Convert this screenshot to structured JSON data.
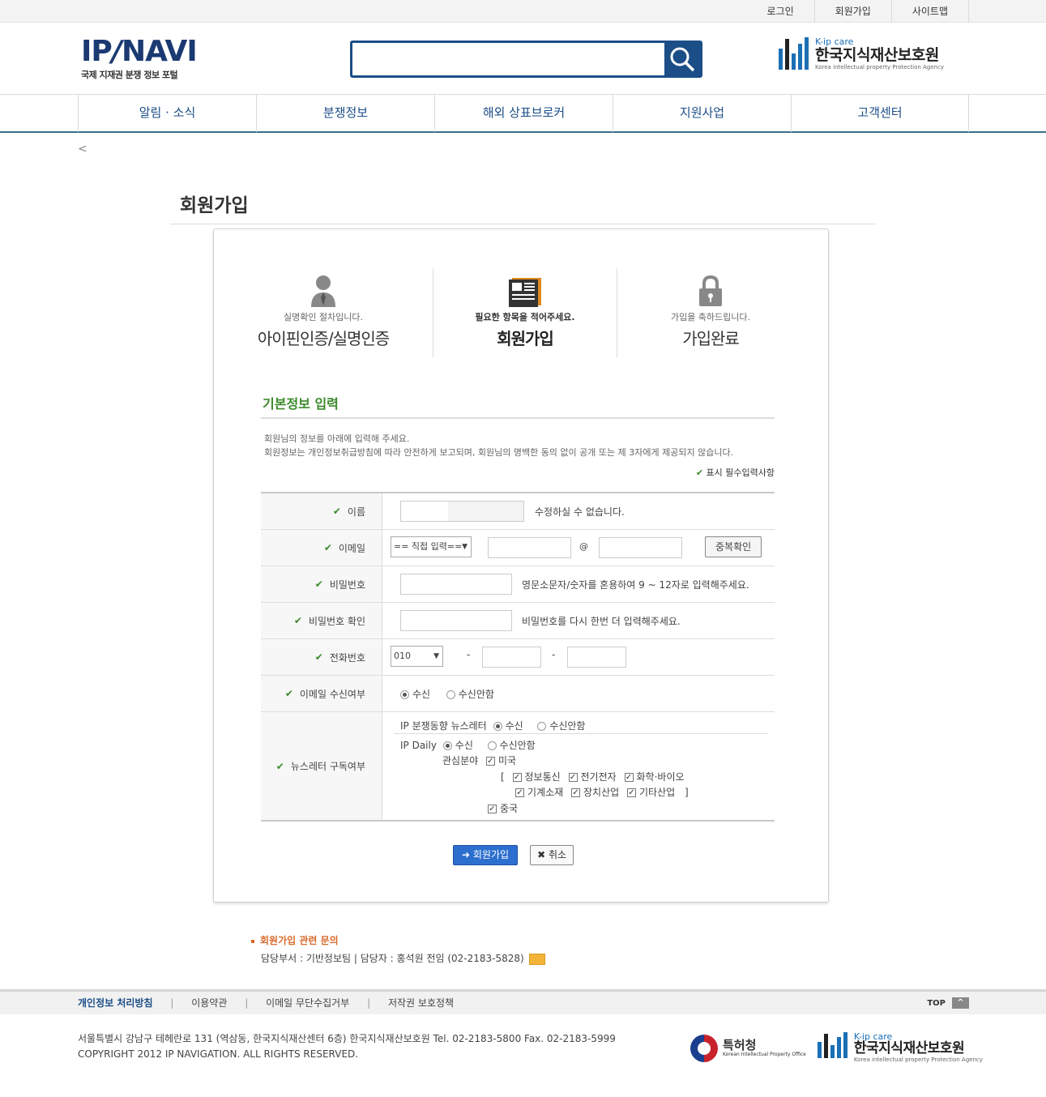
{
  "topbar": {
    "links": [
      "로그인",
      "회원가입",
      "사이트맵"
    ]
  },
  "header": {
    "logo_main_left": "IP",
    "logo_main_slash": "/",
    "logo_main_right": "NAVI",
    "logo_sub": "국제 지재권 분쟁 정보 포털",
    "search_placeholder": "",
    "partner_small": "K-ip care",
    "partner_name": "한국지식재산보호원",
    "partner_english": "Korea intellectual property Protection Agency"
  },
  "nav": {
    "items": [
      "알림 · 소식",
      "분쟁정보",
      "해외 상표브로커",
      "지원사업",
      "고객센터"
    ]
  },
  "back_icon": "<",
  "page_title": "회원가입",
  "steps": [
    {
      "desc": "실명확인 절차입니다.",
      "name": "아이핀인증/실명인증",
      "icon": "user-icon"
    },
    {
      "desc": "필요한 항목을 적어주세요.",
      "name": "회원가입",
      "icon": "newspaper-icon"
    },
    {
      "desc": "가입을 축하드립니다.",
      "name": "가입완료",
      "icon": "lock-icon"
    }
  ],
  "section": {
    "title": "기본정보 입력",
    "intro1": "회원님의 정보를 아래에 입력해 주세요.",
    "intro2": "회원정보는 개인정보취급방침에 따라 안전하게 보고되며, 회원님의 명백한 동의 없이 공개 또는 제 3자에게 제공되지 않습니다.",
    "required_note": "표시 필수입력사항",
    "check_mark": "✔"
  },
  "form": {
    "name": {
      "label": "이름",
      "note": "수정하실 수 없습니다."
    },
    "email": {
      "label": "이메일",
      "domain_select": "== 직접 입력==",
      "at": "@",
      "dup_button": "중복확인"
    },
    "password": {
      "label": "비밀번호",
      "note": "영문소문자/숫자를 혼용하여 9 ~ 12자로 입력해주세요."
    },
    "password_confirm": {
      "label": "비밀번호 확인",
      "note": "비밀번호를 다시 한번 더 입력해주세요."
    },
    "phone": {
      "label": "전화번호",
      "prefix": "010",
      "dash": "-"
    },
    "email_receive": {
      "label": "이메일 수신여부",
      "yes": "수신",
      "no": "수신안함"
    },
    "newsletter": {
      "label": "뉴스레터 구독여부",
      "trend_label": "IP 분쟁동향 뉴스레터",
      "daily_label": "IP Daily",
      "yes": "수신",
      "no": "수신안함",
      "interest_label": "관심분야",
      "us": "미국",
      "bracket_open": "[",
      "bracket_close": "]",
      "fields1": [
        "정보통신",
        "전기전자",
        "화학·바이오"
      ],
      "fields2": [
        "기계소재",
        "장치산업",
        "기타산업"
      ],
      "china": "중국"
    }
  },
  "buttons": {
    "join": "회원가입",
    "join_icon": "➜",
    "cancel": "취소",
    "cancel_icon": "✖"
  },
  "inquiry": {
    "title": "회원가입 관련 문의",
    "contact": "담당부서 : 기반정보팀 | 담당자 : 홍석원 전임 (02-2183-5828)"
  },
  "footer": {
    "links": [
      "개인정보 처리방침",
      "이용약관",
      "이메일 무단수집거부",
      "저작권 보호정책"
    ],
    "separator": "|",
    "top_label": "TOP",
    "top_icon": "^",
    "address": "서울특별시 강남구 테헤란로 131 (역삼동, 한국지식재산센터 6층) 한국지식재산보호원 Tel. 02-2183-5800 Fax. 02-2183-5999",
    "copyright": "COPYRIGHT 2012 IP NAVIGATION. ALL RIGHTS RESERVED.",
    "kipo_name": "특허청",
    "kipo_english": "Korean Intellectual Property Office",
    "kip_small": "K-ip care",
    "kip_name": "한국지식재산보호원",
    "kip_english": "Korea intellectual property Protection Agency"
  },
  "colors": {
    "brand": "#1b4e87",
    "green": "#3b8a2b",
    "orange": "#d96a2b"
  }
}
